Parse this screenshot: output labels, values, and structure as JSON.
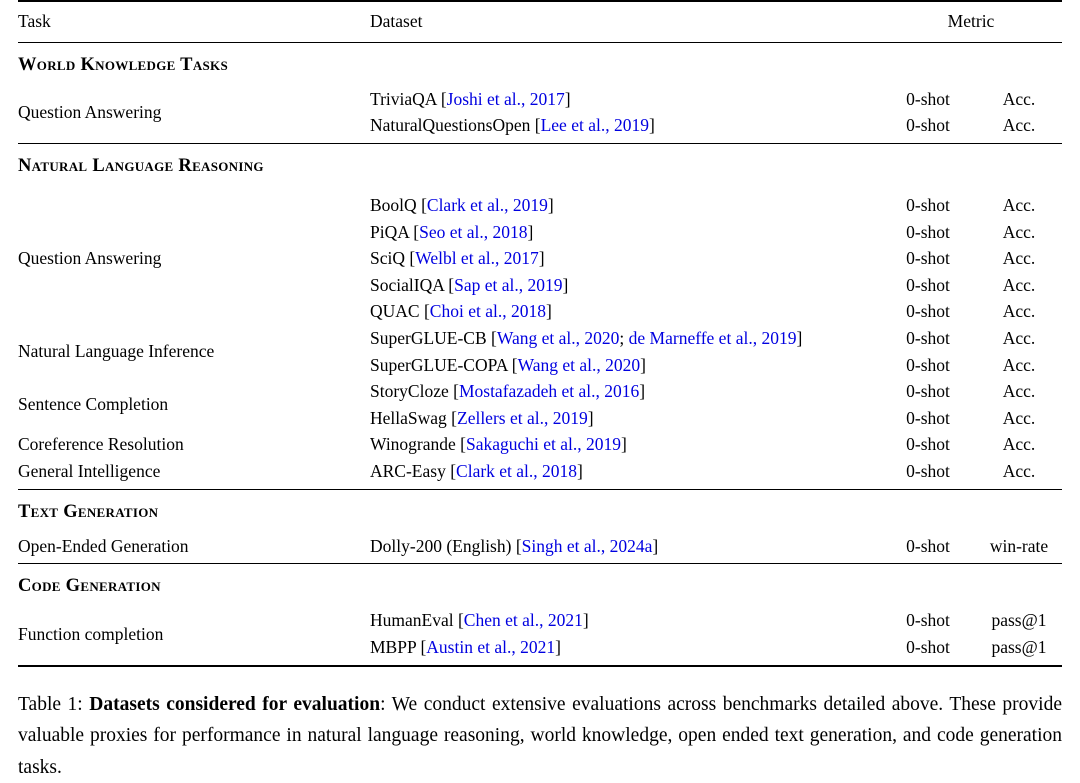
{
  "table": {
    "label": "Table 1",
    "columns": {
      "task": "Task",
      "dataset": "Dataset",
      "metric": "Metric"
    },
    "link_color": "#0000e0",
    "sections": [
      {
        "heading": "World Knowledge Tasks",
        "rows": [
          {
            "task": "Question Answering",
            "task_rowspan": 2,
            "entries": [
              {
                "dataset": "TriviaQA",
                "citation": "Joshi et al., 2017",
                "shot": "0-shot",
                "metric": "Acc."
              },
              {
                "dataset": "NaturalQuestionsOpen",
                "citation": "Lee et al., 2019",
                "shot": "0-shot",
                "metric": "Acc."
              }
            ]
          }
        ]
      },
      {
        "heading": "Natural Language Reasoning",
        "rows": [
          {
            "task": "Question Answering",
            "task_rowspan": 5,
            "entries": [
              {
                "dataset": "BoolQ",
                "citation": "Clark et al., 2019",
                "shot": "0-shot",
                "metric": "Acc."
              },
              {
                "dataset": "PiQA",
                "citation": "Seo et al., 2018",
                "shot": "0-shot",
                "metric": "Acc."
              },
              {
                "dataset": "SciQ",
                "citation": "Welbl et al., 2017",
                "shot": "0-shot",
                "metric": "Acc."
              },
              {
                "dataset": "SocialIQA ",
                "citation": "Sap et al., 2019",
                "shot": "0-shot",
                "metric": "Acc."
              },
              {
                "dataset": "QUAC",
                "citation": "Choi et al., 2018",
                "shot": "0-shot",
                "metric": "Acc."
              }
            ]
          },
          {
            "task": "Natural Language Inference",
            "task_rowspan": 2,
            "entries": [
              {
                "dataset": "SuperGLUE-CB",
                "citation": "Wang et al., 2020",
                "citation2": "de Marneffe et al., 2019",
                "shot": "0-shot",
                "metric": "Acc."
              },
              {
                "dataset": "SuperGLUE-COPA",
                "citation": "Wang et al., 2020",
                "shot": "0-shot",
                "metric": "Acc."
              }
            ]
          },
          {
            "task": "Sentence Completion",
            "task_rowspan": 2,
            "entries": [
              {
                "dataset": "StoryCloze",
                "citation": "Mostafazadeh et al., 2016",
                "shot": "0-shot",
                "metric": "Acc."
              },
              {
                "dataset": "HellaSwag",
                "citation": "Zellers et al., 2019",
                "shot": "0-shot",
                "metric": "Acc."
              }
            ]
          },
          {
            "task": "Coreference Resolution",
            "task_rowspan": 1,
            "entries": [
              {
                "dataset": "Winogrande",
                "citation": "Sakaguchi et al., 2019",
                "shot": "0-shot",
                "metric": "Acc."
              }
            ]
          },
          {
            "task": "General Intelligence",
            "task_rowspan": 1,
            "entries": [
              {
                "dataset": "ARC-Easy",
                "citation": "Clark et al., 2018",
                "shot": "0-shot",
                "metric": "Acc."
              }
            ]
          }
        ]
      },
      {
        "heading": "Text Generation",
        "rows": [
          {
            "task": "Open-Ended Generation",
            "task_rowspan": 1,
            "entries": [
              {
                "dataset": "Dolly-200 (English) ",
                "citation": "Singh et al., 2024a",
                "shot": "0-shot",
                "metric": "win-rate"
              }
            ]
          }
        ]
      },
      {
        "heading": "Code Generation",
        "rows": [
          {
            "task": "Function completion",
            "task_rowspan": 2,
            "entries": [
              {
                "dataset": "HumanEval",
                "citation": "Chen et al., 2021",
                "shot": "0-shot",
                "metric": "pass@1"
              },
              {
                "dataset": "MBPP",
                "citation": "Austin et al., 2021",
                "shot": "0-shot",
                "metric": "pass@1"
              }
            ]
          }
        ]
      }
    ]
  },
  "caption": {
    "prefix": "Table 1:",
    "bold_title": "Datasets considered for evaluation",
    "body": ": We conduct extensive evaluations across benchmarks detailed above.  These provide valuable proxies for performance in natural language reasoning, world knowledge, open ended text generation, and code generation tasks."
  }
}
